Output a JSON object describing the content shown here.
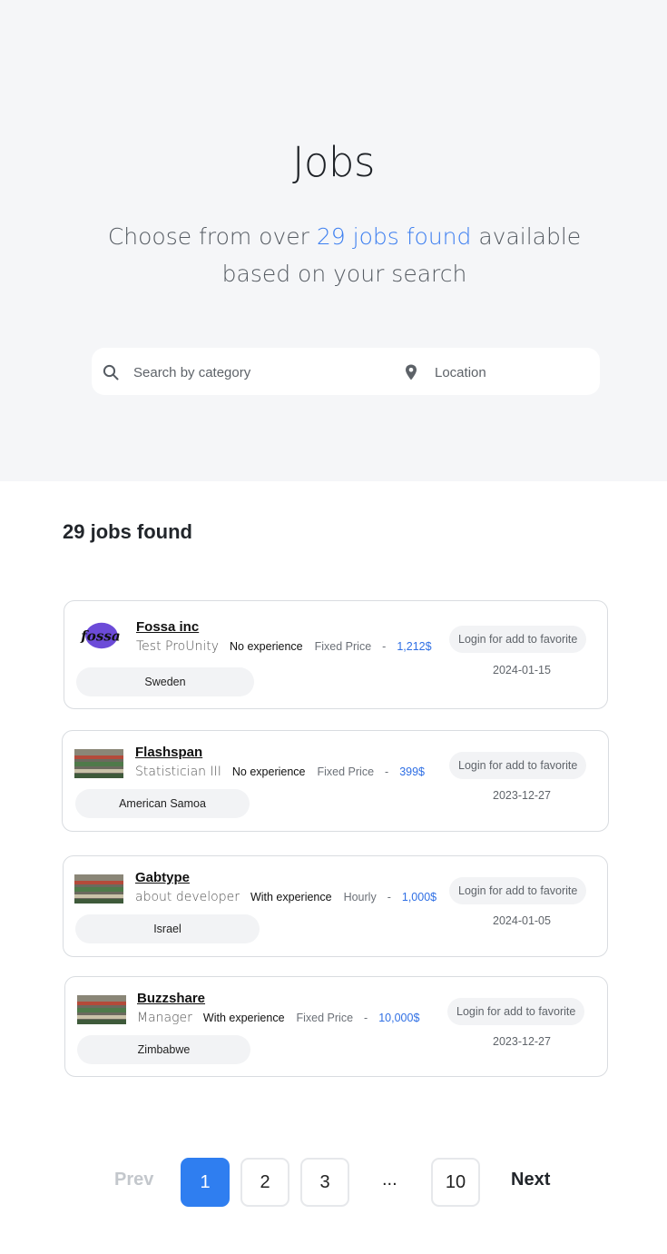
{
  "hero": {
    "title": "Jobs",
    "subtitle_pre": "Choose from over ",
    "subtitle_highlight": "29 jobs found",
    "subtitle_mid": " available",
    "subtitle_post": "based on your search"
  },
  "search": {
    "category_placeholder": "Search by category",
    "location_placeholder": "Location"
  },
  "results": {
    "count_label": "29 jobs found"
  },
  "jobs": [
    {
      "company": "Fossa inc",
      "role": "Test ProUnity",
      "experience": "No experience",
      "price_type": "Fixed Price",
      "separator": "-",
      "price": "1,212$",
      "country": "Sweden",
      "favorite_label": "Login for add to favorite",
      "date": "2024-01-15",
      "logo": "fossa-logo"
    },
    {
      "company": "Flashspan",
      "role": "Statistician III",
      "experience": "No experience",
      "price_type": "Fixed Price",
      "separator": "-",
      "price": "399$",
      "country": "American Samoa",
      "favorite_label": "Login for add to favorite",
      "date": "2023-12-27",
      "logo": "crowd-photo"
    },
    {
      "company": "Gabtype",
      "role": "about developer",
      "experience": "With experience",
      "price_type": "Hourly",
      "separator": "-",
      "price": "1,000$",
      "country": "Israel",
      "favorite_label": "Login for add to favorite",
      "date": "2024-01-05",
      "logo": "crowd-photo"
    },
    {
      "company": "Buzzshare",
      "role": "Manager",
      "experience": "With experience",
      "price_type": "Fixed Price",
      "separator": "-",
      "price": "10,000$",
      "country": "Zimbabwe",
      "favorite_label": "Login for add to favorite",
      "date": "2023-12-27",
      "logo": "crowd-photo"
    }
  ],
  "pagination": {
    "prev": "Prev",
    "pages": [
      "1",
      "2",
      "3"
    ],
    "ellipsis": "...",
    "last": "10",
    "next": "Next",
    "current": "1"
  },
  "colors": {
    "accent": "#2f7ef0",
    "price": "#2f6fe4",
    "hero_bg": "#f5f6f8",
    "highlight": "#3d7ff0"
  },
  "icons": {
    "search": "search-icon",
    "location": "map-pin-icon"
  }
}
